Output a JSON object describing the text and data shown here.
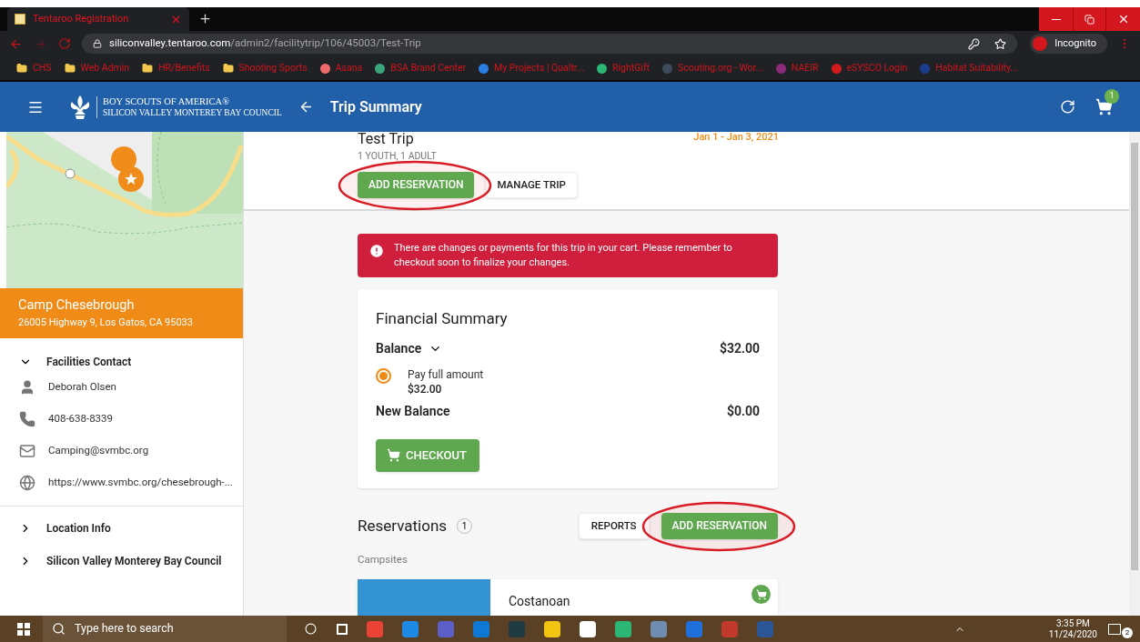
{
  "browser": {
    "tab_title": "Tentaroo Registration",
    "url_host": "siliconvalley.tentaroo.com",
    "url_path": "/admin2/facilitytrip/106/45003/Test-Trip",
    "profile": "Incognito",
    "bookmarks": [
      {
        "kind": "folder",
        "label": "CHS"
      },
      {
        "kind": "folder",
        "label": "Web Admin"
      },
      {
        "kind": "folder",
        "label": "HR/Benefits"
      },
      {
        "kind": "folder",
        "label": "Shooting Sports"
      },
      {
        "kind": "site",
        "label": "Asana",
        "color": "#f06a6a"
      },
      {
        "kind": "site",
        "label": "BSA Brand Center",
        "color": "#3aa57a"
      },
      {
        "kind": "site",
        "label": "My Projects | Qualtr...",
        "color": "#2a7de1"
      },
      {
        "kind": "site",
        "label": "RightGift",
        "color": "#2bb673"
      },
      {
        "kind": "site",
        "label": "Scouting.org - Wor...",
        "color": "#3c4a5c"
      },
      {
        "kind": "site",
        "label": "NAEIR",
        "color": "#8a2a7a"
      },
      {
        "kind": "site",
        "label": "eSYSCO Login",
        "color": "#d01c1c"
      },
      {
        "kind": "site",
        "label": "Habitat Suitability...",
        "color": "#1c3c8c"
      }
    ]
  },
  "header": {
    "org_line1": "BOY SCOUTS OF AMERICA®",
    "org_line2": "SILICON VALLEY MONTEREY BAY COUNCIL",
    "title": "Trip Summary",
    "cart_count": "1"
  },
  "sidebar": {
    "camp_name": "Camp Chesebrough",
    "camp_address": "26005 Highway 9, Los Gatos, CA 95033",
    "contact": {
      "title": "Facilities Contact",
      "expanded": true,
      "items": [
        {
          "kind": "person",
          "text": "Deborah Olsen"
        },
        {
          "kind": "phone",
          "text": "408-638-8339"
        },
        {
          "kind": "email",
          "text": "Camping@svmbc.org"
        },
        {
          "kind": "web",
          "text": "https://www.svmbc.org/chesebrough-..."
        }
      ]
    },
    "sections": [
      {
        "title": "Location Info",
        "expanded": false
      },
      {
        "title": "Silicon Valley Monterey Bay Council",
        "expanded": false
      }
    ]
  },
  "trip": {
    "name": "Test Trip",
    "participants": "1 YOUTH, 1 ADULT",
    "dates": "Jan 1 - Jan 3, 2021",
    "add_button": {
      "label": "ADD RESERVATION",
      "highlighted": true
    },
    "manage_button": "MANAGE TRIP"
  },
  "alert": "There are changes or payments for this trip in your cart. Please remember to checkout soon to finalize your changes.",
  "financial": {
    "title": "Financial Summary",
    "balance_label": "Balance",
    "balance_expanded": true,
    "balance": "$32.00",
    "options": [
      {
        "label": "Pay full amount",
        "amount": "$32.00",
        "selected": true
      }
    ],
    "new_balance_label": "New Balance",
    "new_balance": "$0.00",
    "checkout": "CHECKOUT"
  },
  "reservations": {
    "title": "Reservations",
    "count": "1",
    "reports_button": "REPORTS",
    "add_button": {
      "label": "ADD RESERVATION",
      "highlighted": true
    },
    "group": "Campsites",
    "items": [
      {
        "name": "Costanoan",
        "in_cart": true
      }
    ]
  },
  "taskbar": {
    "search_placeholder": "Type here to search",
    "time": "3:35 PM",
    "date": "11/24/2020",
    "notifications": "2"
  }
}
